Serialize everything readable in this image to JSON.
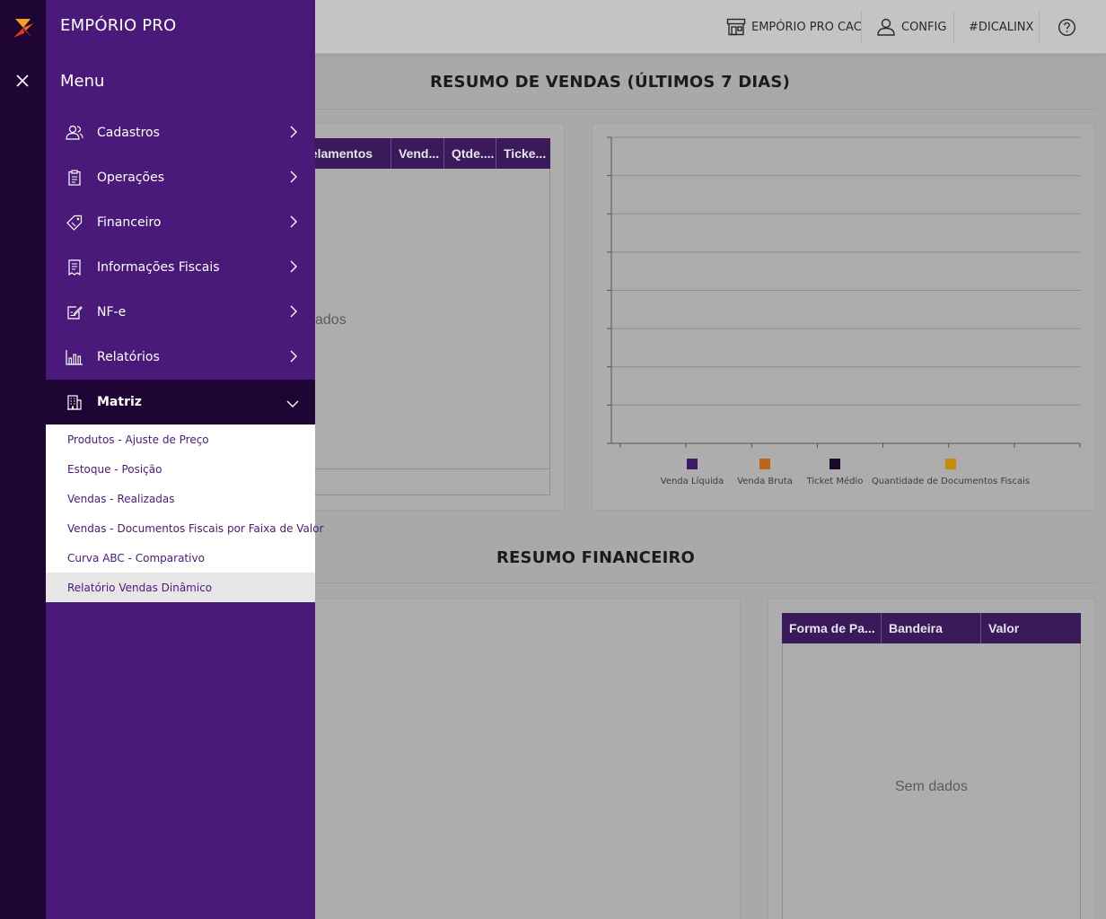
{
  "topbar": {
    "store_label": "EMPÓRIO PRO CAC",
    "config_label": "CONFIG",
    "tip_label": "#DICALINX"
  },
  "sales_summary": {
    "title": "RESUMO DE VENDAS (ÚLTIMOS 7 DIAS)",
    "table": {
      "columns": [
        "celamentos",
        "Vend...",
        "Qtde....",
        "Ticke..."
      ],
      "empty_text": "ados"
    },
    "chart_legend": [
      "Venda Líquida",
      "Venda Bruta",
      "Ticket Médio",
      "Quantidade de Documentos Fiscais"
    ],
    "chart_colors": [
      "#3b1a6a",
      "#b8661a",
      "#1a0a2a",
      "#c98a0a"
    ]
  },
  "financial_summary": {
    "title": "RESUMO FINANCEIRO",
    "table": {
      "columns": [
        "Forma de Pa...",
        "Bandeira",
        "Valor"
      ],
      "empty_text": "Sem dados"
    }
  },
  "sidebar": {
    "brand": "EMPÓRIO PRO",
    "menu_title": "Menu",
    "items": [
      {
        "label": "Cadastros",
        "icon": "users-icon"
      },
      {
        "label": "Operações",
        "icon": "clipboard-icon"
      },
      {
        "label": "Financeiro",
        "icon": "tag-icon"
      },
      {
        "label": "Informações Fiscais",
        "icon": "receipt-icon"
      },
      {
        "label": "NF-e",
        "icon": "edit-document-icon"
      },
      {
        "label": "Relatórios",
        "icon": "bar-chart-icon"
      },
      {
        "label": "Matriz",
        "icon": "building-icon"
      }
    ],
    "submenu": [
      "Produtos - Ajuste de Preço",
      "Estoque - Posição",
      "Vendas - Realizadas",
      "Vendas - Documentos Fiscais por Faixa de Valor",
      "Curva ABC - Comparativo",
      "Relatório Vendas Dinâmico"
    ]
  },
  "colors": {
    "drawer": "#4a1a7a",
    "rail": "#1f0533",
    "table_header": "#3b1a5b"
  }
}
